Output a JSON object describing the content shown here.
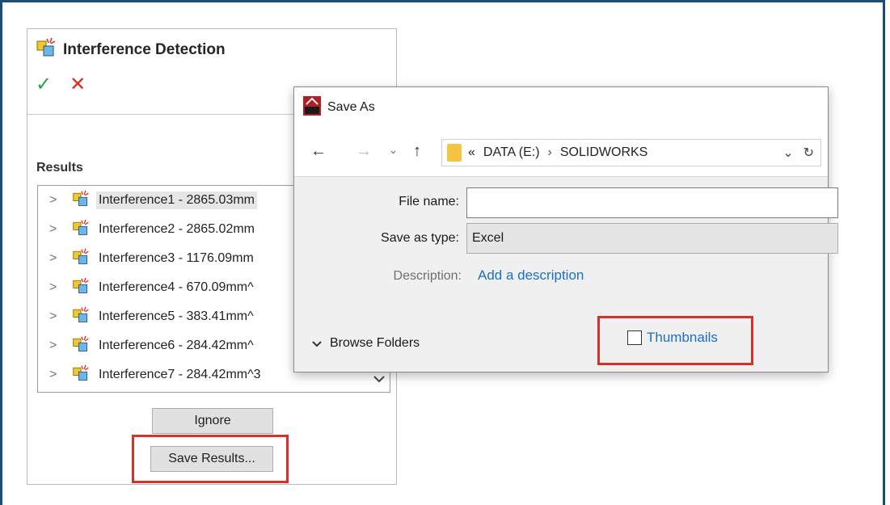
{
  "property_manager": {
    "title": "Interference Detection",
    "results_label": "Results",
    "rows": [
      {
        "label": "Interference1 - 2865.03mm"
      },
      {
        "label": "Interference2 - 2865.02mm"
      },
      {
        "label": "Interference3 - 1176.09mm"
      },
      {
        "label": "Interference4 - 670.09mm^"
      },
      {
        "label": "Interference5 - 383.41mm^"
      },
      {
        "label": "Interference6 - 284.42mm^"
      },
      {
        "label": "Interference7 - 284.42mm^3"
      }
    ],
    "ignore_label": "Ignore",
    "save_results_label": "Save Results..."
  },
  "dialog": {
    "title": "Save As",
    "address": {
      "prefix": "«",
      "segments": [
        "DATA (E:)",
        "SOLIDWORKS"
      ]
    },
    "file_name_label": "File name:",
    "file_name_value": "",
    "save_as_type_label": "Save as type:",
    "save_as_type_value": "Excel",
    "description_label": "Description:",
    "description_link": "Add a description",
    "browse_folders_label": "Browse Folders",
    "thumbnails_label": "Thumbnails"
  },
  "colors": {
    "highlight_red": "#d9312a",
    "link_blue": "#1a6fc9",
    "accept_green": "#2ea043",
    "cancel_red": "#e0291c",
    "frame_blue": "#1b4f7a"
  }
}
